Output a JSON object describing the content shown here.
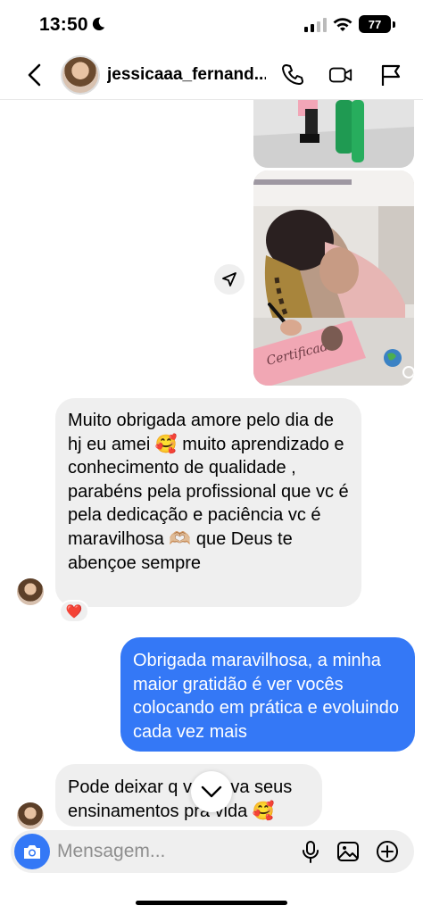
{
  "status_bar": {
    "time": "13:50",
    "battery": "77"
  },
  "header": {
    "username": "jessicaaa_fernand...",
    "icons": [
      "back-icon",
      "phone-icon",
      "video-icon",
      "flag-icon"
    ]
  },
  "media": {
    "certificate_text": "Certificado",
    "icons": [
      "share-icon"
    ]
  },
  "messages": [
    {
      "direction": "incoming",
      "text": "Muito obrigada amore pelo dia de hj eu amei 🥰 muito aprendizado e conhecimento de qualidade , parabéns pela profissional que vc é pela dedicação e paciência vc é maravilhosa 🫶🏼 que Deus te abençoe sempre",
      "reaction": "❤️"
    },
    {
      "direction": "outgoing",
      "text": "Obrigada maravilhosa, a minha maior gratidão é ver vocês colocando em prática e evoluindo cada vez mais"
    },
    {
      "direction": "incoming",
      "text": "Pode deixar q vou leva seus ensinamentos pra vida 🥰"
    }
  ],
  "composer": {
    "placeholder": "Mensagem..."
  },
  "colors": {
    "outgoing_bubble": "#3478f6",
    "incoming_bubble": "#efefef",
    "accent": "#3478f6"
  }
}
